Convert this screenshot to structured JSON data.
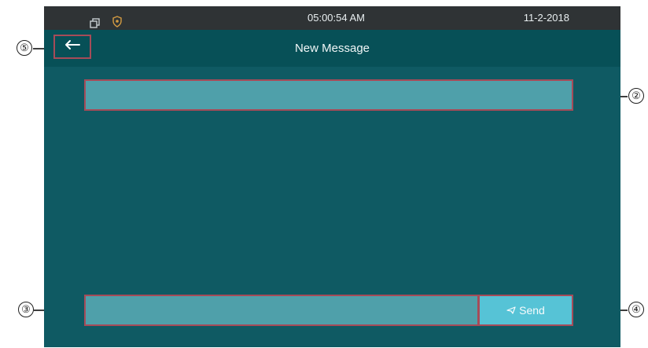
{
  "status_bar": {
    "icons": [
      "window-icon",
      "shield-icon"
    ],
    "time": "05:00:54  AM",
    "date": "11-2-2018"
  },
  "title_bar": {
    "back_icon": "arrow-left-icon",
    "title": "New Message"
  },
  "compose": {
    "recipient_value": "",
    "message_value": "",
    "send_label": "Send",
    "send_icon": "send-icon"
  },
  "annotations": {
    "back": "⑤",
    "recipient": "②",
    "message": "③",
    "send": "④"
  },
  "colors": {
    "background": "#0f5a63",
    "status_bar": "#2f3335",
    "title_bar": "#075057",
    "field": "#4fa0aa",
    "send_button": "#56c3d6",
    "highlight": "#a64b58"
  }
}
